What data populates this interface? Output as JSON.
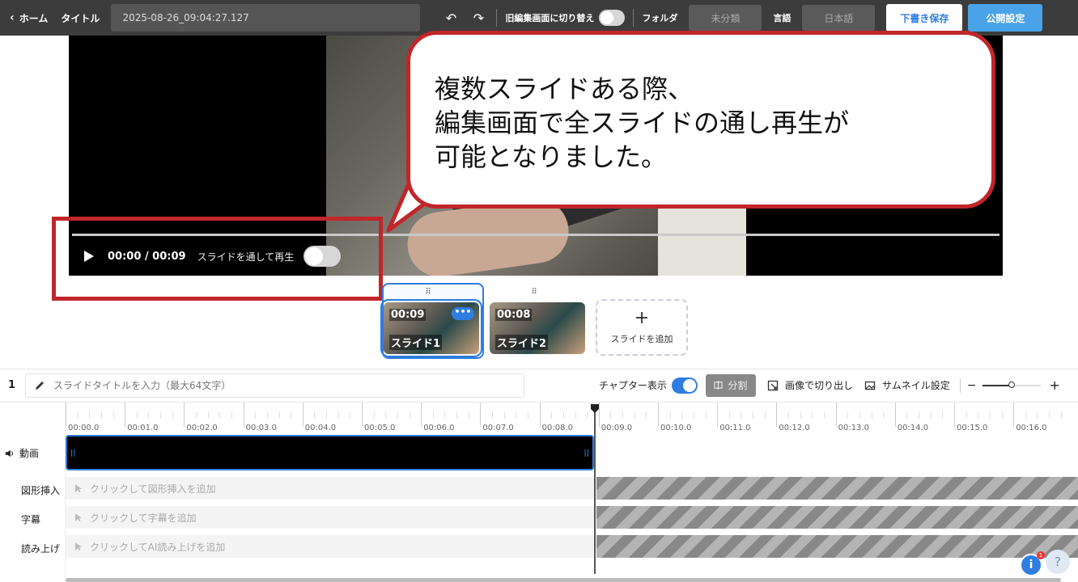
{
  "header": {
    "home_label": "ホーム",
    "title_label": "タイトル",
    "title_value": "2025-08-26_09:04:27.127",
    "legacy_switch_label": "旧編集画面に切り替え",
    "folder_label": "フォルダ",
    "folder_value": "未分類",
    "language_label": "言語",
    "language_value": "日本語",
    "draft_save_label": "下書き保存",
    "publish_label": "公開設定"
  },
  "player": {
    "time": "00:00 / 00:09",
    "play_through_label": "スライドを通して再生",
    "play_through_on": false
  },
  "callout": {
    "lines": [
      "複数スライドある際、",
      "編集画面で全スライドの通し再生が",
      "可能となりました。"
    ]
  },
  "slides": [
    {
      "duration": "00:09",
      "name": "スライド1",
      "selected": true
    },
    {
      "duration": "00:08",
      "name": "スライド2",
      "selected": false
    }
  ],
  "add_slide_label": "スライドを追加",
  "editor": {
    "slide_number": "1",
    "title_placeholder": "スライドタイトルを入力（最大64文字）",
    "chapter_label": "チャプター表示",
    "chapter_on": true,
    "split_label": "分割",
    "crop_label": "画像で切り出し",
    "thumbnail_label": "サムネイル設定",
    "zoom_level": 0.5
  },
  "timeline": {
    "ticks": [
      "00:00.0",
      "00:01.0",
      "00:02.0",
      "00:03.0",
      "00:04.0",
      "00:05.0",
      "00:06.0",
      "00:07.0",
      "00:08.0",
      "00:09.0",
      "00:10.0",
      "00:11.0",
      "00:12.0",
      "00:13.0",
      "00:14.0",
      "00:15.0",
      "00:16.0"
    ],
    "tracks": {
      "video": "動画",
      "shape": "図形挿入",
      "subtitle": "字幕",
      "tts": "読み上げ"
    },
    "lanes": {
      "shape": "クリックして図形挿入を追加",
      "subtitle": "クリックして字幕を追加",
      "tts": "クリックしてAI読み上げを追加"
    }
  },
  "help": {
    "info_icon": "i",
    "badge_count": "1",
    "question_icon": "?"
  },
  "colors": {
    "accent": "#2f7de1",
    "callout_border": "#c0262a",
    "topbar": "#3c3c3c"
  }
}
